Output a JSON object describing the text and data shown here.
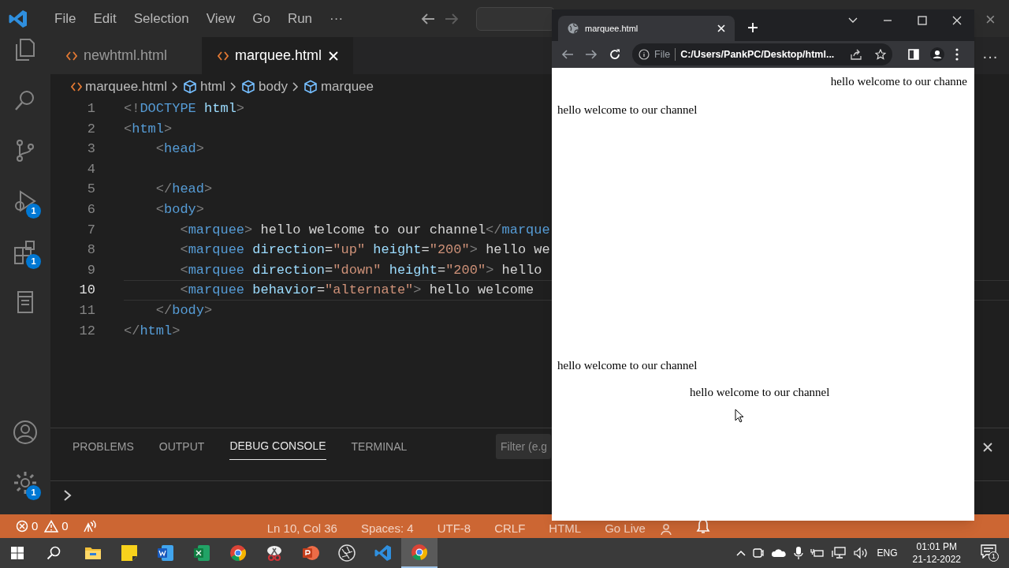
{
  "title_bar": {
    "menu": [
      "File",
      "Edit",
      "Selection",
      "View",
      "Go",
      "Run",
      "···"
    ],
    "close": "×",
    "editor_actions": "···"
  },
  "activity_bar": {
    "items": [
      {
        "kind": "files"
      },
      {
        "kind": "search"
      },
      {
        "kind": "branch"
      },
      {
        "kind": "debug",
        "badge": "1"
      },
      {
        "kind": "extensions",
        "badge": "1"
      },
      {
        "kind": "notebook"
      }
    ],
    "bottom": [
      {
        "kind": "account"
      },
      {
        "kind": "settings",
        "badge": "1"
      }
    ]
  },
  "editor_tabs": [
    {
      "label": "newhtml.html",
      "selected": false
    },
    {
      "label": "marquee.html",
      "selected": true
    }
  ],
  "breadcrumbs": [
    {
      "kind": "file",
      "label": "marquee.html"
    },
    {
      "kind": "element",
      "label": "html"
    },
    {
      "kind": "element",
      "label": "body"
    },
    {
      "kind": "element",
      "label": "marquee"
    }
  ],
  "code": [
    {
      "number": "1",
      "current": false,
      "tokens": [
        {
          "kind": "punct",
          "text": "<!"
        },
        {
          "kind": "tag",
          "text": "DOCTYPE"
        },
        {
          "kind": "attr",
          "text": " html"
        },
        {
          "kind": "punct",
          "text": ">"
        }
      ]
    },
    {
      "number": "2",
      "current": false,
      "tokens": [
        {
          "kind": "punct",
          "text": "<"
        },
        {
          "kind": "tag",
          "text": "html"
        },
        {
          "kind": "punct",
          "text": ">"
        }
      ]
    },
    {
      "number": "3",
      "current": false,
      "tokens": [
        {
          "kind": "punct",
          "text": "    <"
        },
        {
          "kind": "tag",
          "text": "head"
        },
        {
          "kind": "punct",
          "text": ">"
        }
      ]
    },
    {
      "number": "4",
      "current": false
    },
    {
      "number": "5",
      "current": false,
      "tokens": [
        {
          "kind": "punct",
          "text": "    </"
        },
        {
          "kind": "tag",
          "text": "head"
        },
        {
          "kind": "punct",
          "text": ">"
        }
      ]
    },
    {
      "number": "6",
      "current": false,
      "tokens": [
        {
          "kind": "punct",
          "text": "    <"
        },
        {
          "kind": "tag",
          "text": "body"
        },
        {
          "kind": "punct",
          "text": ">"
        }
      ]
    },
    {
      "number": "7",
      "current": false,
      "tokens": [
        {
          "kind": "punct",
          "text": "       <"
        },
        {
          "kind": "tag",
          "text": "marquee"
        },
        {
          "kind": "punct",
          "text": ">"
        },
        {
          "kind": "text",
          "text": " hello welcome to our channel"
        },
        {
          "kind": "punct",
          "text": "</"
        },
        {
          "kind": "tag",
          "text": "marque"
        }
      ]
    },
    {
      "number": "8",
      "current": false,
      "tokens": [
        {
          "kind": "punct",
          "text": "       <"
        },
        {
          "kind": "tag",
          "text": "marquee"
        },
        {
          "kind": "attr",
          "text": " direction"
        },
        {
          "kind": "text",
          "text": "="
        },
        {
          "kind": "string",
          "text": "\"up\""
        },
        {
          "kind": "attr",
          "text": " height"
        },
        {
          "kind": "text",
          "text": "="
        },
        {
          "kind": "string",
          "text": "\"200\""
        },
        {
          "kind": "punct",
          "text": ">"
        },
        {
          "kind": "text",
          "text": " hello we"
        }
      ]
    },
    {
      "number": "9",
      "current": false,
      "tokens": [
        {
          "kind": "punct",
          "text": "       <"
        },
        {
          "kind": "tag",
          "text": "marquee"
        },
        {
          "kind": "attr",
          "text": " direction"
        },
        {
          "kind": "text",
          "text": "="
        },
        {
          "kind": "string",
          "text": "\"down\""
        },
        {
          "kind": "attr",
          "text": " height"
        },
        {
          "kind": "text",
          "text": "="
        },
        {
          "kind": "string",
          "text": "\"200\""
        },
        {
          "kind": "punct",
          "text": ">"
        },
        {
          "kind": "text",
          "text": " hello"
        }
      ]
    },
    {
      "number": "10",
      "current": true,
      "tokens": [
        {
          "kind": "punct",
          "text": "       <"
        },
        {
          "kind": "tag",
          "text": "marquee"
        },
        {
          "kind": "attr",
          "text": " behavior"
        },
        {
          "kind": "text",
          "text": "="
        },
        {
          "kind": "string",
          "text": "\"alternate\""
        },
        {
          "kind": "punct",
          "text": ">"
        },
        {
          "kind": "text",
          "text": " hello welcome"
        }
      ]
    },
    {
      "number": "11",
      "current": false,
      "tokens": [
        {
          "kind": "punct",
          "text": "    </"
        },
        {
          "kind": "tag",
          "text": "body"
        },
        {
          "kind": "punct",
          "text": ">"
        }
      ]
    },
    {
      "number": "12",
      "current": false,
      "tokens": [
        {
          "kind": "punct",
          "text": "</"
        },
        {
          "kind": "tag",
          "text": "html"
        },
        {
          "kind": "punct",
          "text": ">"
        }
      ]
    }
  ],
  "panel": {
    "tabs": [
      {
        "label": "PROBLEMS",
        "selected": false
      },
      {
        "label": "OUTPUT",
        "selected": false
      },
      {
        "label": "DEBUG CONSOLE",
        "selected": true
      },
      {
        "label": "TERMINAL",
        "selected": false
      }
    ],
    "filter_placeholder": "Filter (e.g"
  },
  "status_bar": {
    "errors": "0",
    "warnings": "0",
    "items": [
      "Ln 10, Col 36",
      "Spaces: 4",
      "UTF-8",
      "CRLF",
      "HTML",
      "Go Live"
    ]
  },
  "browser": {
    "tab_title": "marquee.html",
    "scheme": "File",
    "url": "C:/Users/PankPC/Desktop/html...",
    "marquees": [
      {
        "kind": "scroll",
        "text": "hello welcome to our channe"
      },
      {
        "kind": "up",
        "text": "hello welcome to our channel"
      },
      {
        "kind": "down",
        "text": "hello welcome to our channel"
      },
      {
        "kind": "alternate",
        "text": "hello welcome to our channel"
      }
    ]
  },
  "taskbar": {
    "apps": [
      {
        "kind": "folder",
        "selected": false
      },
      {
        "kind": "note",
        "selected": false
      },
      {
        "kind": "word",
        "selected": false
      },
      {
        "kind": "sheet",
        "selected": false
      },
      {
        "kind": "browser",
        "selected": false
      },
      {
        "kind": "snip",
        "selected": false
      },
      {
        "kind": "slides",
        "selected": false
      },
      {
        "kind": "aperture",
        "selected": false
      },
      {
        "kind": "code",
        "selected": false
      },
      {
        "kind": "browser",
        "selected": true
      }
    ],
    "language": "ENG",
    "time": "01:01 PM",
    "date": "21-12-2022",
    "notifications": "1"
  }
}
